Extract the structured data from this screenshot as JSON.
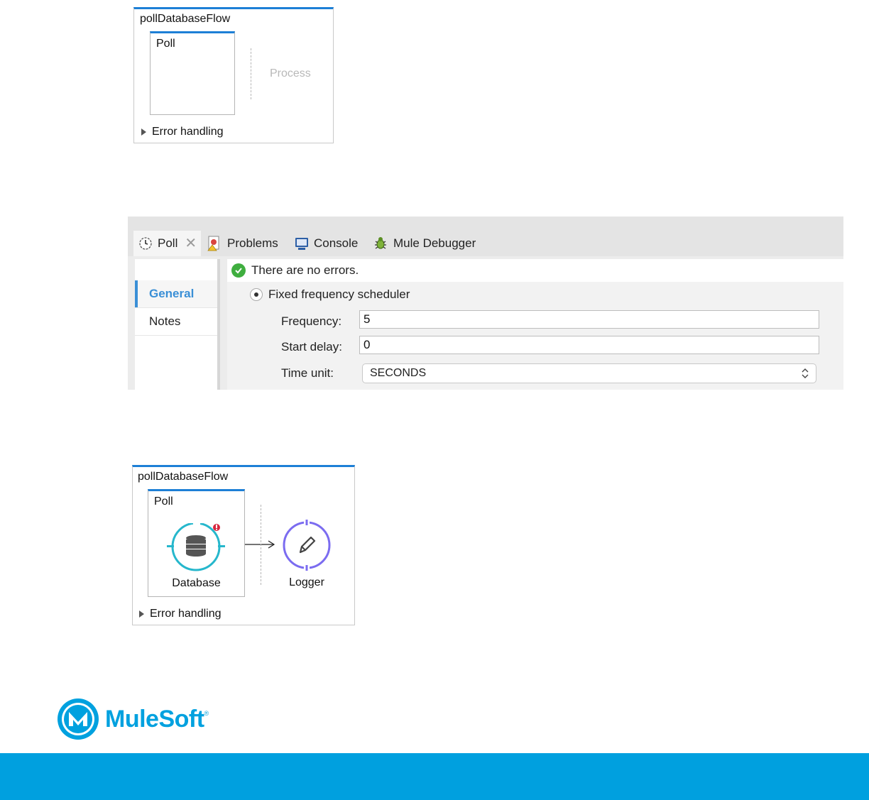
{
  "flow1": {
    "title": "pollDatabaseFlow",
    "scope_label": "Poll",
    "process_placeholder": "Process",
    "error_handling": "Error handling"
  },
  "properties": {
    "tabs": [
      {
        "label": "Poll",
        "icon": "clock-icon"
      },
      {
        "label": "Problems",
        "icon": "problems-icon"
      },
      {
        "label": "Console",
        "icon": "console-icon"
      },
      {
        "label": "Mule Debugger",
        "icon": "bug-icon"
      }
    ],
    "sidebar": [
      "General",
      "Notes"
    ],
    "message": "There are no errors.",
    "scheduler_label": "Fixed frequency scheduler",
    "fields": {
      "frequency_label": "Frequency:",
      "frequency_value": "5",
      "start_delay_label": "Start delay:",
      "start_delay_value": "0",
      "time_unit_label": "Time unit:",
      "time_unit_value": "SECONDS"
    }
  },
  "flow2": {
    "title": "pollDatabaseFlow",
    "scope_label": "Poll",
    "database_label": "Database",
    "logger_label": "Logger",
    "error_handling": "Error handling"
  },
  "logo": {
    "text": "MuleSoft",
    "tm": "®"
  },
  "colors": {
    "accent": "#1d7fd6",
    "brand": "#00a0df",
    "database": "#26b7cc",
    "logger": "#7b6cf0",
    "error_badge": "#d7263d"
  }
}
